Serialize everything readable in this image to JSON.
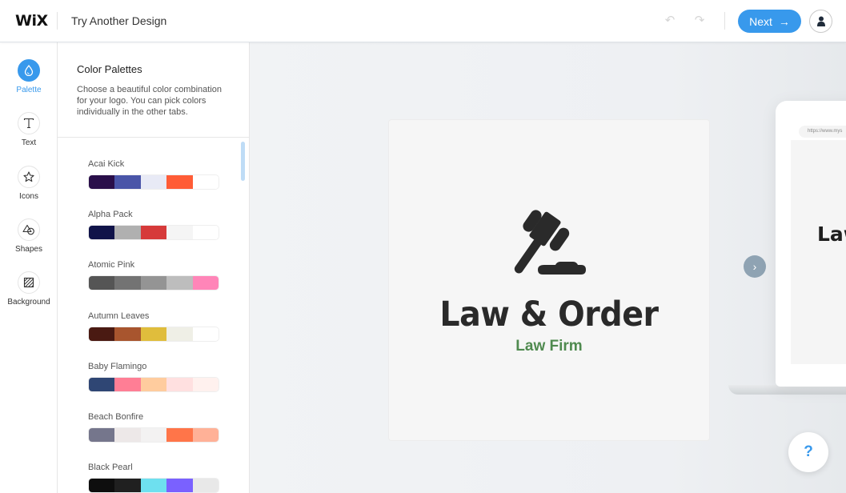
{
  "header": {
    "logo": "WiX",
    "title": "Try Another Design",
    "undo_icon": "↶",
    "redo_icon": "↷",
    "next_label": "Next",
    "next_icon": "→"
  },
  "rail": {
    "items": [
      {
        "label": "Palette",
        "icon": "palette-drop-icon",
        "active": true
      },
      {
        "label": "Text",
        "icon": "text-icon",
        "active": false
      },
      {
        "label": "Icons",
        "icon": "star-icon",
        "active": false
      },
      {
        "label": "Shapes",
        "icon": "shapes-icon",
        "active": false
      },
      {
        "label": "Background",
        "icon": "background-hatch-icon",
        "active": false
      }
    ]
  },
  "panel": {
    "title": "Color Palettes",
    "description": "Choose a beautiful color combination for your logo. You can pick colors individually in the other tabs.",
    "palettes": [
      {
        "name": "Acai Kick",
        "colors": [
          "#2a0f4a",
          "#4a55a8",
          "#e8eaf6",
          "#ff5c36",
          "#ffffff"
        ]
      },
      {
        "name": "Alpha Pack",
        "colors": [
          "#101349",
          "#b0b0b0",
          "#d63a3a",
          "#f5f5f5",
          "#ffffff"
        ]
      },
      {
        "name": "Atomic Pink",
        "colors": [
          "#555555",
          "#737373",
          "#949494",
          "#bdbdbd",
          "#ff85b8"
        ]
      },
      {
        "name": "Autumn Leaves",
        "colors": [
          "#4a1a12",
          "#a8552e",
          "#e0bd3c",
          "#efefe6",
          "#ffffff"
        ]
      },
      {
        "name": "Baby Flamingo",
        "colors": [
          "#2f4674",
          "#ff7e95",
          "#ffcc9e",
          "#ffe0e0",
          "#fff1ee"
        ]
      },
      {
        "name": "Beach Bonfire",
        "colors": [
          "#75768c",
          "#ede8e8",
          "#f3f2f2",
          "#ff7549",
          "#ffb197"
        ]
      },
      {
        "name": "Black Pearl",
        "colors": [
          "#0e0e0e",
          "#202020",
          "#6ee0ef",
          "#7a61ff",
          "#e8e8e8"
        ]
      }
    ]
  },
  "canvas": {
    "logo_title": "Law & Order",
    "logo_subtitle": "Law Firm",
    "logo_icon": "gavel-icon",
    "logo_title_color": "#2a2a2a",
    "logo_subtitle_color": "#4f8a4f",
    "preview_url": "https://www.mys",
    "preview_logo_text": "Law",
    "help_label": "?",
    "next_design_icon": "›"
  },
  "colors": {
    "accent": "#3899ec",
    "rail_active": "#3899ec"
  }
}
